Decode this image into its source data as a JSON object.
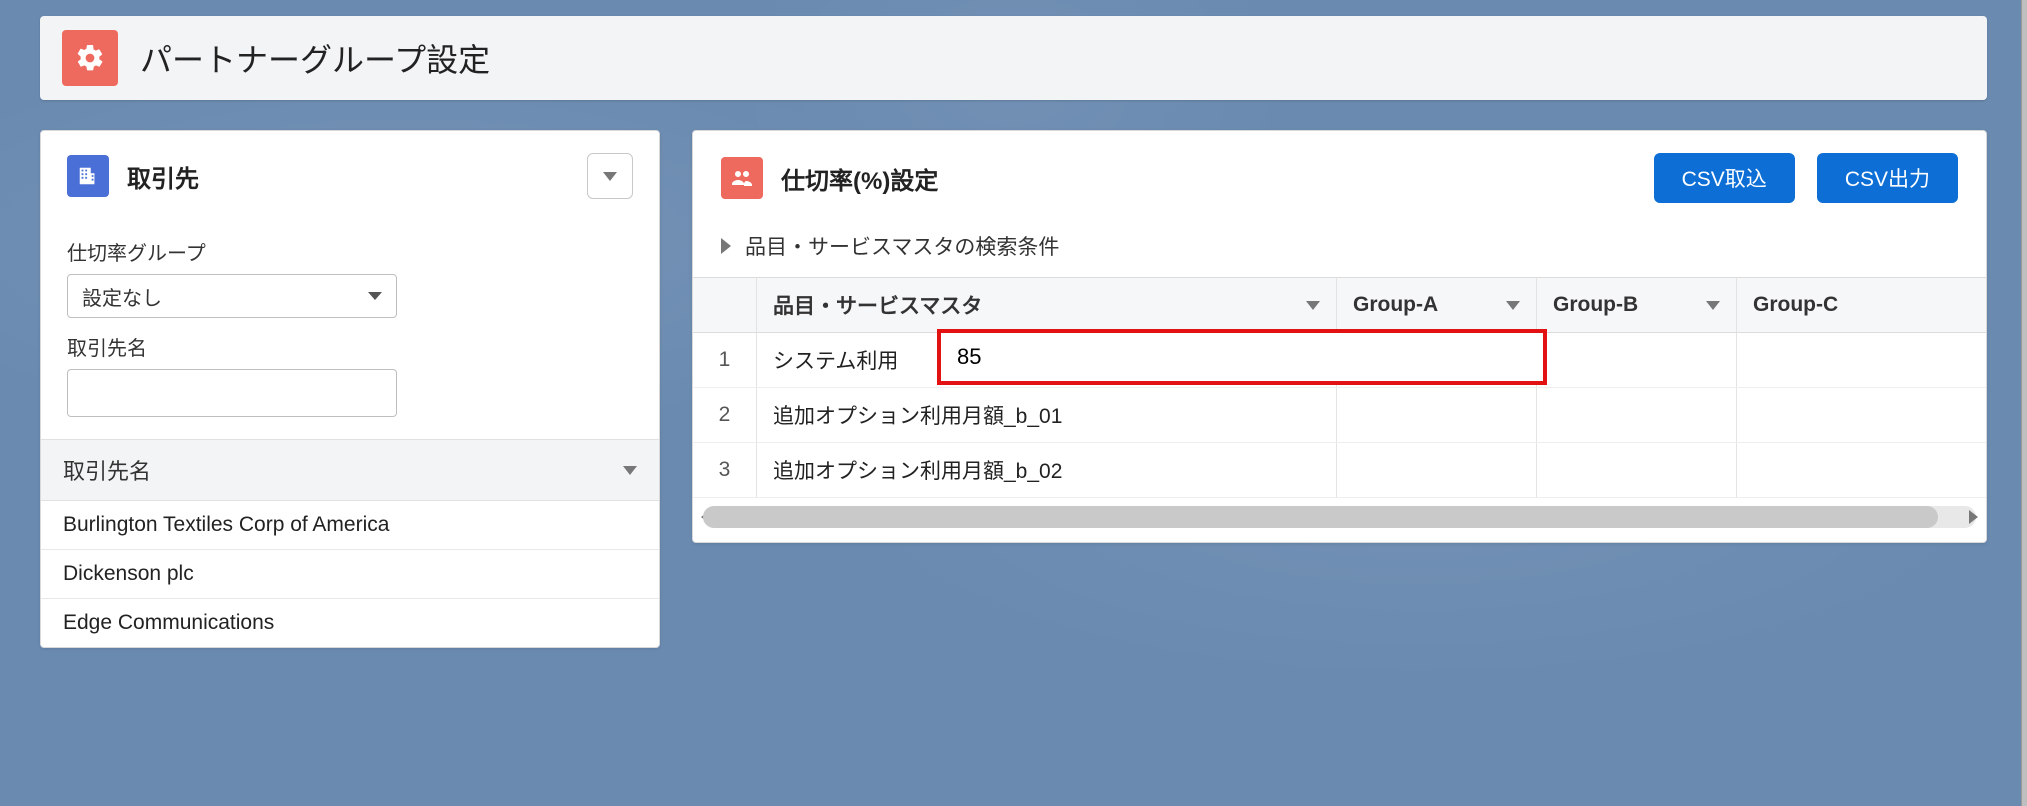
{
  "header": {
    "title": "パートナーグループ設定",
    "icon": "gears-icon"
  },
  "left": {
    "title": "取引先",
    "icon": "building-icon",
    "group_label": "仕切率グループ",
    "group_value": "設定なし",
    "name_label": "取引先名",
    "name_value": "",
    "accounts_header": "取引先名",
    "accounts": [
      "Burlington Textiles Corp of America",
      "Dickenson plc",
      "Edge Communications"
    ]
  },
  "right": {
    "title": "仕切率(%)設定",
    "icon": "people-icon",
    "csv_import_label": "CSV取込",
    "csv_export_label": "CSV出力",
    "search_toggle_label": "品目・サービスマスタの検索条件",
    "columns": {
      "name": "品目・サービスマスタ",
      "ga": "Group-A",
      "gb": "Group-B",
      "gc": "Group-C"
    },
    "rows": [
      {
        "num": "1",
        "name": "システム利用",
        "ga": "",
        "gb": "",
        "gc": ""
      },
      {
        "num": "2",
        "name": "追加オプション利用月額_b_01",
        "ga": "",
        "gb": "",
        "gc": ""
      },
      {
        "num": "3",
        "name": "追加オプション利用月額_b_02",
        "ga": "",
        "gb": "",
        "gc": ""
      }
    ],
    "editing_value": "85"
  },
  "colors": {
    "accent_red": "#ee6a5f",
    "accent_blue": "#0d6fd6",
    "highlight_border": "#e21212"
  }
}
